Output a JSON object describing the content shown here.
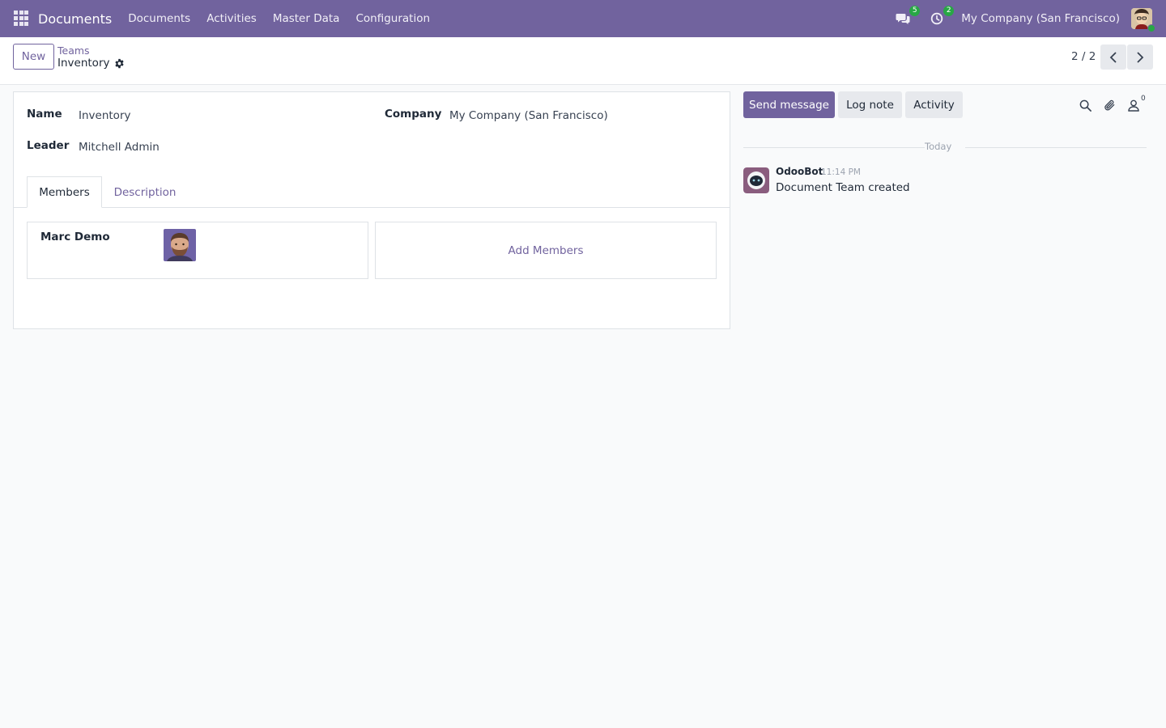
{
  "navbar": {
    "app_name": "Documents",
    "menu": [
      "Documents",
      "Activities",
      "Master Data",
      "Configuration"
    ],
    "messages_badge": "5",
    "activities_badge": "2",
    "company": "My Company (San Francisco)",
    "brand_color": "#71639e"
  },
  "control_panel": {
    "new_label": "New",
    "breadcrumb_parent": "Teams",
    "breadcrumb_current": "Inventory",
    "pager": "2 / 2"
  },
  "form": {
    "name_label": "Name",
    "name_value": "Inventory",
    "leader_label": "Leader",
    "leader_value": "Mitchell Admin",
    "company_label": "Company",
    "company_value": "My Company (San Francisco)",
    "tabs": [
      "Members",
      "Description"
    ],
    "members": [
      {
        "name": "Marc Demo"
      }
    ],
    "add_members_label": "Add Members"
  },
  "chatter": {
    "send_message": "Send message",
    "log_note": "Log note",
    "activity": "Activity",
    "followers_count": "0",
    "date_separator": "Today",
    "messages": [
      {
        "author": "OdooBot",
        "time": "11:14 PM",
        "body": "Document Team created"
      }
    ]
  }
}
